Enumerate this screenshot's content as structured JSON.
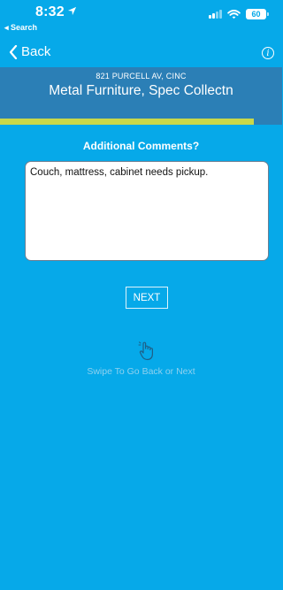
{
  "status_bar": {
    "time": "8:32",
    "back_app": "◂ Search",
    "battery": "60"
  },
  "nav": {
    "back_label": "Back",
    "info_glyph": "i"
  },
  "header": {
    "address": "821 PURCELL AV, CINC",
    "title": "Metal Furniture, Spec Collectn"
  },
  "progress": {
    "fraction": 0.9
  },
  "form": {
    "prompt": "Additional Comments?",
    "comment_value": "Couch, mattress, cabinet needs pickup.",
    "next_label": "NEXT",
    "swipe_hint": "Swipe To Go Back or Next"
  },
  "colors": {
    "background": "#06a9e9",
    "header_band": "#2b7fb6",
    "progress": "#c9d84a"
  },
  "icons": [
    "location-arrow-icon",
    "signal-icon",
    "wifi-icon",
    "battery-icon",
    "chevron-left-icon",
    "info-icon",
    "hand-swipe-icon"
  ]
}
